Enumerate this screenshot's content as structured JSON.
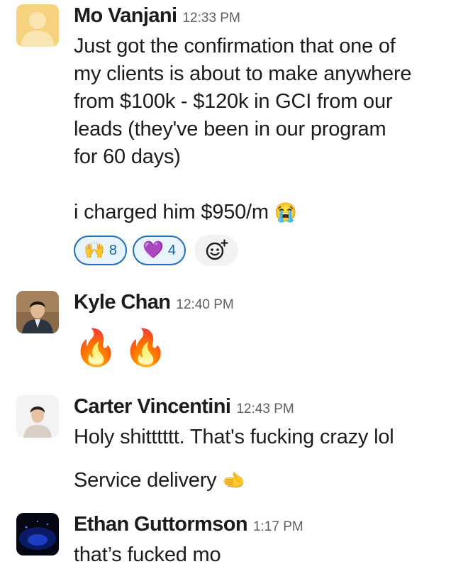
{
  "messages": [
    {
      "name": "Mo Vanjani",
      "time": "12:33 PM",
      "avatar": "default-user-avatar",
      "text": "Just got the confirmation that one of\nmy clients is about to make anywhere\nfrom $100k - $120k in GCI from our\nleads (they've been in our program\nfor 60 days)\n\ni charged him $950/m",
      "text_emoji": "😭",
      "reactions": [
        {
          "emoji": "🙌",
          "icon": "raising-hands-icon",
          "count": "8"
        },
        {
          "emoji": "💜",
          "icon": "purple-heart-icon",
          "count": "4"
        }
      ],
      "add_reaction_icon": "add-reaction-icon"
    },
    {
      "name": "Kyle Chan",
      "time": "12:40 PM",
      "avatar": "kyle-chan-photo",
      "emojis": "🔥🔥"
    },
    {
      "name": "Carter Vincentini",
      "time": "12:43 PM",
      "avatar": "carter-vincentini-photo",
      "text": "Holy shitttttt. That's fucking crazy lol",
      "text2": "Service delivery",
      "text2_emoji": "🫲"
    },
    {
      "name": "Ethan Guttormson",
      "time": "1:17 PM",
      "avatar": "ethan-guttormson-photo",
      "text": "that’s fucked mo"
    }
  ],
  "colors": {
    "reaction_border": "#1d6fb8",
    "reaction_bg": "#e8f3fc",
    "timestamp": "#616061",
    "default_avatar": "#f4c65a"
  }
}
